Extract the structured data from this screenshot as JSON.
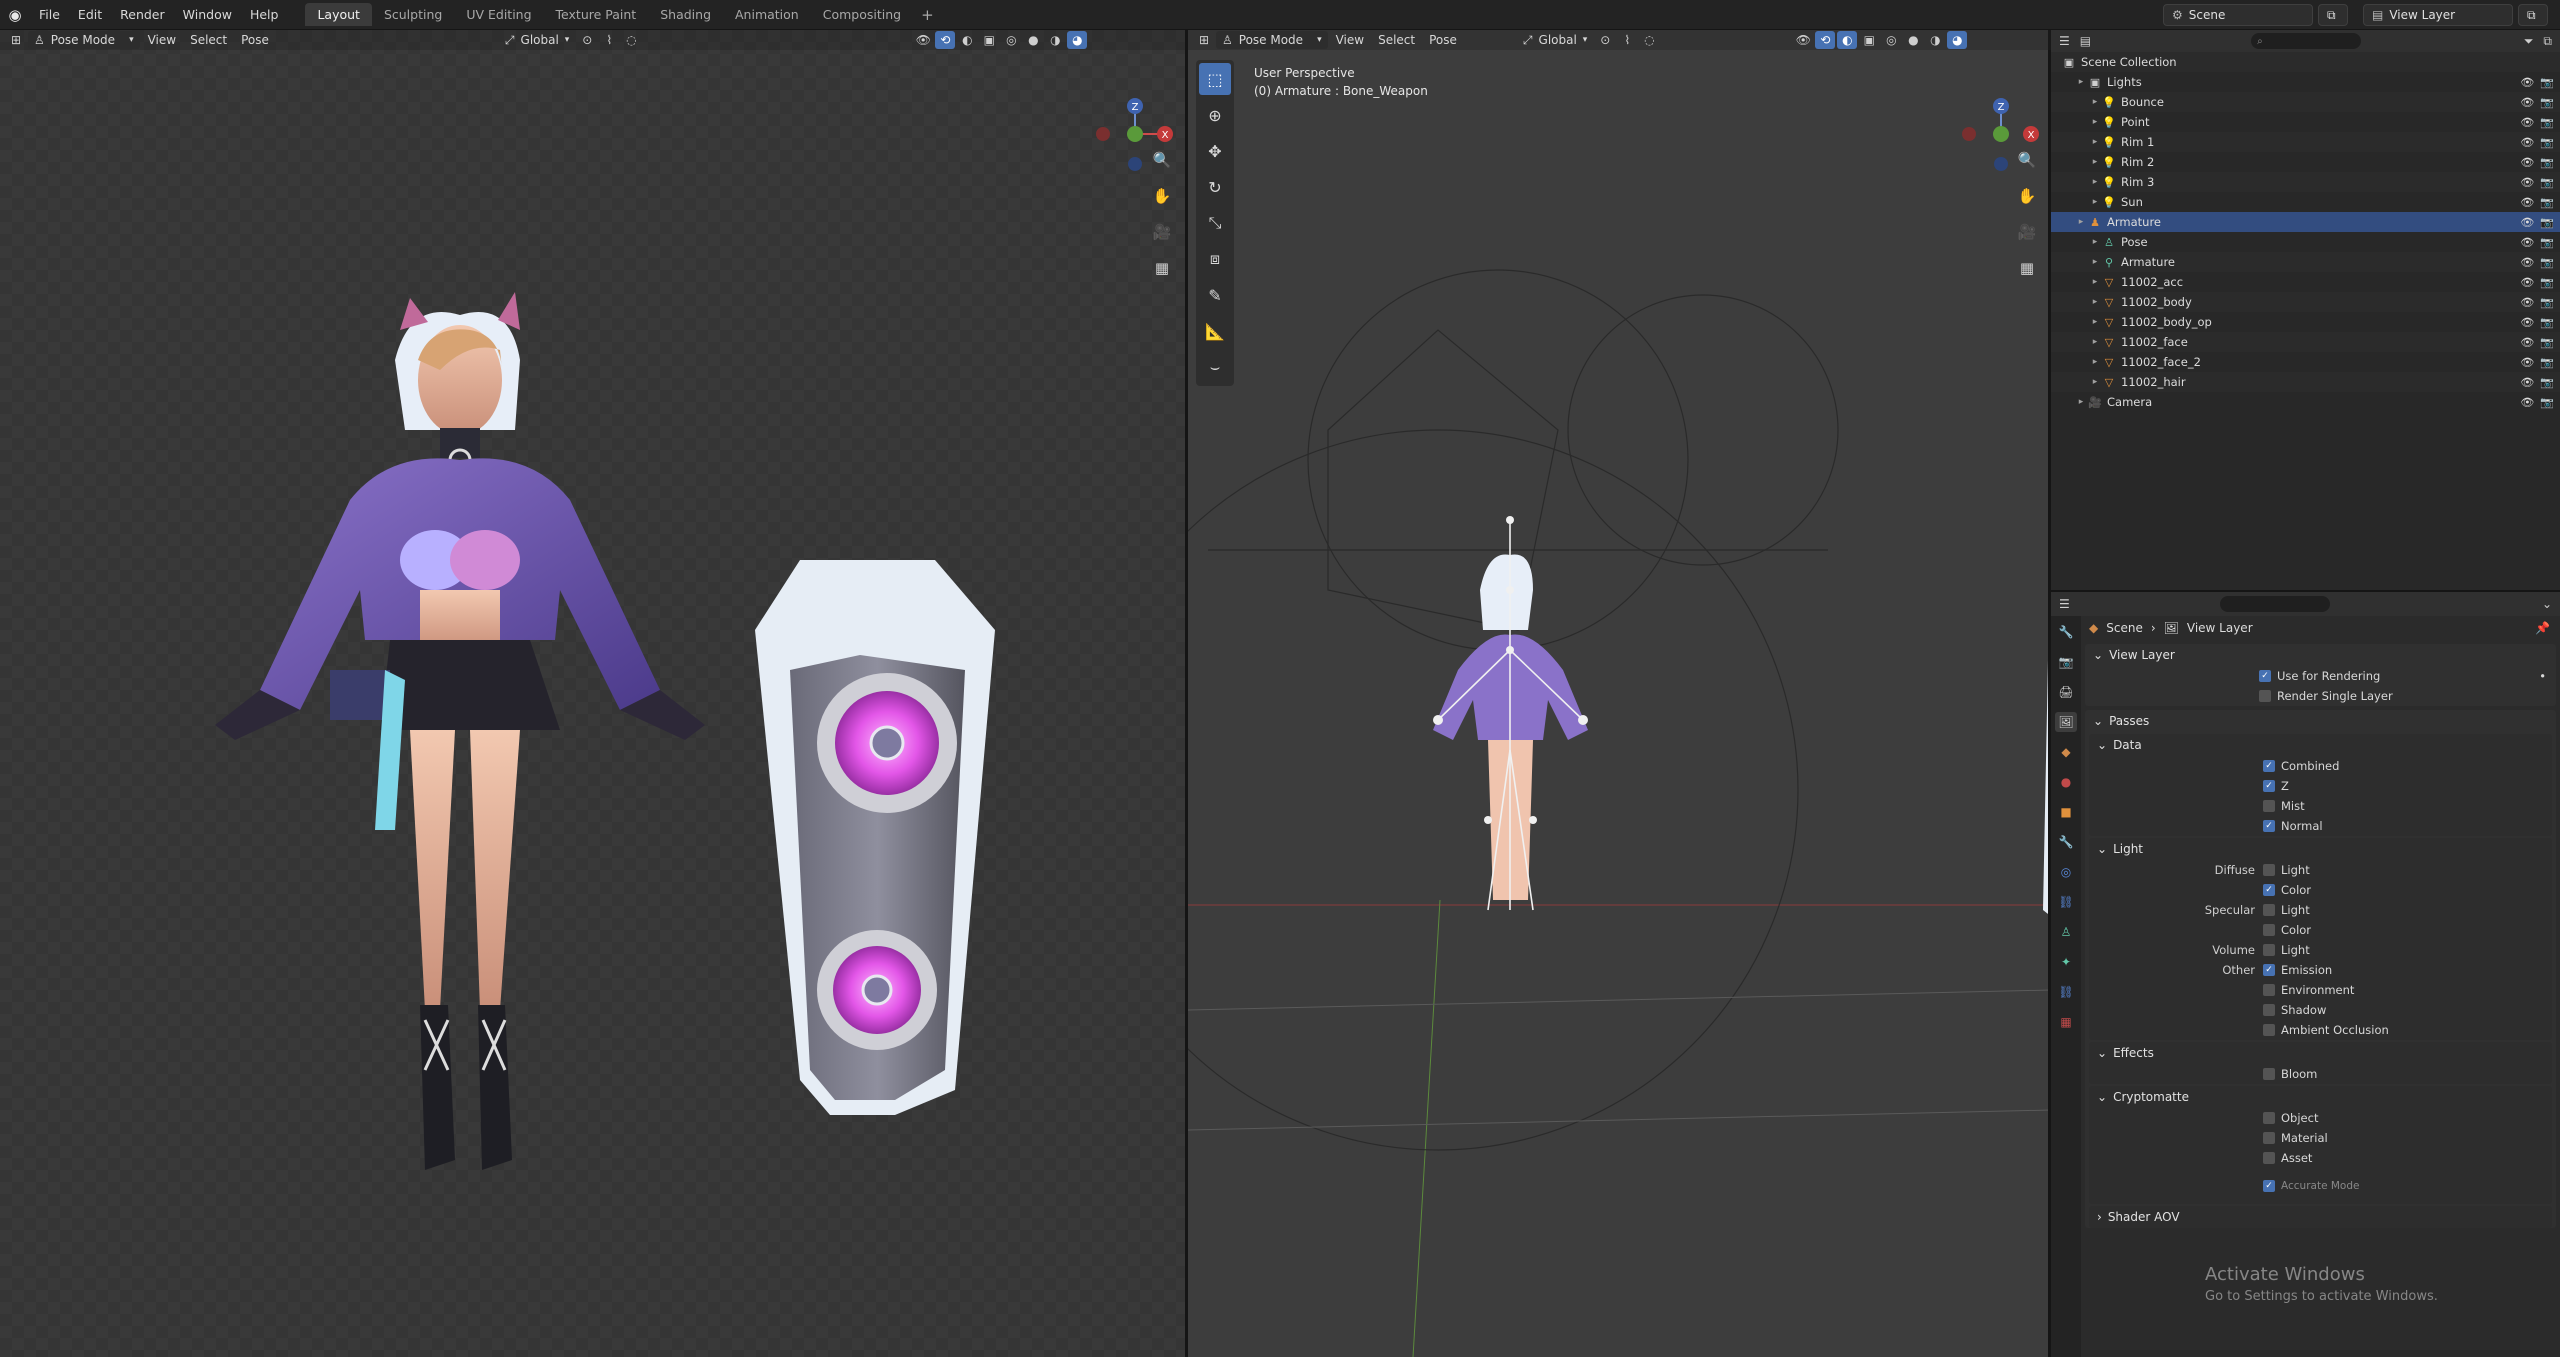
{
  "menu": [
    "File",
    "Edit",
    "Render",
    "Window",
    "Help"
  ],
  "workspaces": [
    "Layout",
    "Sculpting",
    "UV Editing",
    "Texture Paint",
    "Shading",
    "Animation",
    "Compositing"
  ],
  "workspace_add": "+",
  "scene_name": "Scene",
  "view_layer_name": "View Layer",
  "viewport_left": {
    "mode": "Pose Mode",
    "menus": [
      "View",
      "Select",
      "Pose"
    ],
    "orientation": "Global"
  },
  "viewport_right": {
    "mode": "Pose Mode",
    "menus": [
      "View",
      "Select",
      "Pose"
    ],
    "orientation": "Global",
    "overlay_line1": "User Perspective",
    "overlay_line2": "(0) Armature : Bone_Weapon"
  },
  "gizmo": {
    "z": "Z",
    "y": "Y",
    "x": "X"
  },
  "outliner": {
    "title": "Scene Collection",
    "rows": [
      {
        "label": "Lights",
        "indent": 1,
        "icon": "collection-icon",
        "color": "#cfcfcf"
      },
      {
        "label": "Bounce",
        "indent": 2,
        "icon": "light-icon",
        "color": "#e0913c"
      },
      {
        "label": "Point",
        "indent": 2,
        "icon": "light-icon",
        "color": "#e0913c"
      },
      {
        "label": "Rim 1",
        "indent": 2,
        "icon": "light-icon",
        "color": "#e0913c"
      },
      {
        "label": "Rim 2",
        "indent": 2,
        "icon": "light-icon",
        "color": "#e0913c"
      },
      {
        "label": "Rim 3",
        "indent": 2,
        "icon": "light-icon",
        "color": "#e0913c"
      },
      {
        "label": "Sun",
        "indent": 2,
        "icon": "light-icon",
        "color": "#e0913c"
      },
      {
        "label": "Armature",
        "indent": 1,
        "icon": "armature-icon",
        "color": "#e0913c",
        "selected": true
      },
      {
        "label": "Pose",
        "indent": 2,
        "icon": "pose-icon",
        "color": "#62c7a8"
      },
      {
        "label": "Armature",
        "indent": 2,
        "icon": "armature-data-icon",
        "color": "#62c7a8"
      },
      {
        "label": "11002_acc",
        "indent": 2,
        "icon": "mesh-icon",
        "color": "#e0913c"
      },
      {
        "label": "11002_body",
        "indent": 2,
        "icon": "mesh-icon",
        "color": "#e0913c"
      },
      {
        "label": "11002_body_op",
        "indent": 2,
        "icon": "mesh-icon",
        "color": "#e0913c"
      },
      {
        "label": "11002_face",
        "indent": 2,
        "icon": "mesh-icon",
        "color": "#e0913c"
      },
      {
        "label": "11002_face_2",
        "indent": 2,
        "icon": "mesh-icon",
        "color": "#e0913c"
      },
      {
        "label": "11002_hair",
        "indent": 2,
        "icon": "mesh-icon",
        "color": "#e0913c"
      },
      {
        "label": "Camera",
        "indent": 1,
        "icon": "camera-icon",
        "color": "#e0913c"
      }
    ]
  },
  "properties": {
    "breadcrumb": [
      "Scene",
      "View Layer"
    ],
    "view_layer_panel": "View Layer",
    "use_for_rendering": "Use for Rendering",
    "render_single_layer": "Render Single Layer",
    "passes_panel": "Passes",
    "data_panel": "Data",
    "data_items": [
      {
        "label": "Combined",
        "on": true
      },
      {
        "label": "Z",
        "on": true
      },
      {
        "label": "Mist",
        "on": false
      },
      {
        "label": "Normal",
        "on": true
      }
    ],
    "light_panel": "Light",
    "light_rows": [
      {
        "group": "Diffuse",
        "label": "Light",
        "on": false
      },
      {
        "group": "",
        "label": "Color",
        "on": true
      },
      {
        "group": "Specular",
        "label": "Light",
        "on": false
      },
      {
        "group": "",
        "label": "Color",
        "on": false
      },
      {
        "group": "Volume",
        "label": "Light",
        "on": false
      },
      {
        "group": "Other",
        "label": "Emission",
        "on": true
      },
      {
        "group": "",
        "label": "Environment",
        "on": false
      },
      {
        "group": "",
        "label": "Shadow",
        "on": false
      },
      {
        "group": "",
        "label": "Ambient Occlusion",
        "on": false
      }
    ],
    "effects_panel": "Effects",
    "bloom": "Bloom",
    "cryptomatte_panel": "Cryptomatte",
    "crypto_items": [
      "Object",
      "Material",
      "Asset"
    ],
    "accurate_mode": "Accurate Mode",
    "shader_aov_panel": "Shader AOV"
  },
  "watermark": {
    "line1": "Activate Windows",
    "line2": "Go to Settings to activate Windows."
  }
}
